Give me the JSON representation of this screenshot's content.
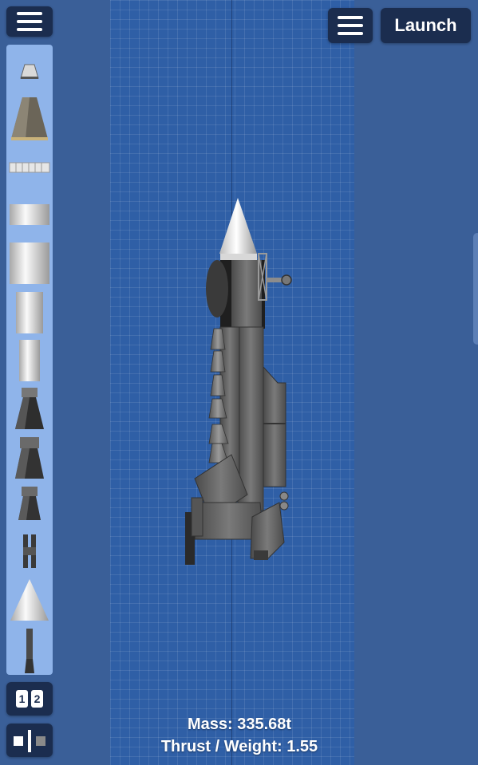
{
  "toolbar": {
    "launch_label": "Launch"
  },
  "palette": {
    "parts": [
      {
        "name": "probe-capsule-part"
      },
      {
        "name": "command-pod-part"
      },
      {
        "name": "separator-ring-part"
      },
      {
        "name": "small-fuel-tank-part"
      },
      {
        "name": "large-fuel-tank-part"
      },
      {
        "name": "tall-fuel-tank-part"
      },
      {
        "name": "narrow-fuel-tank-part"
      },
      {
        "name": "large-engine-part"
      },
      {
        "name": "medium-engine-part"
      },
      {
        "name": "small-engine-part"
      },
      {
        "name": "side-separator-part"
      },
      {
        "name": "nose-cone-part"
      },
      {
        "name": "landing-leg-part"
      }
    ]
  },
  "stages": {
    "first": "1",
    "second": "2"
  },
  "stats": {
    "mass": "Mass: 335.68t",
    "thrust_weight": "Thrust / Weight: 1.55"
  },
  "colors": {
    "background": "#3a5f98",
    "grid": "#2f5fa6",
    "button": "#1b2d4f",
    "palette": "#8fb4ea"
  }
}
